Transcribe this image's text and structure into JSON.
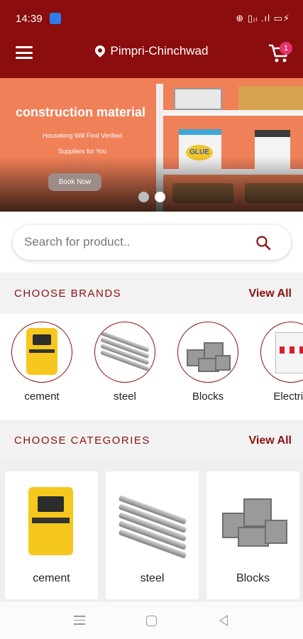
{
  "colors": {
    "brand": "#8b0d0d",
    "accent_text": "#8b1010",
    "badge": "#e4336a",
    "banner_bg": "#f08058"
  },
  "status_bar": {
    "time": "14:39",
    "icons": "⊕ ▯ᵢₗ .ıl ▭⚡"
  },
  "header": {
    "location": "Pimpri-Chinchwad",
    "cart_count": "1"
  },
  "banner": {
    "title": "construction material",
    "subtitle_line1": "Houseking Will Find Verified",
    "subtitle_line2": "Suppliers for You",
    "button": "Book Now",
    "glue_label": "GLUE",
    "slides": 2,
    "active_slide": 2
  },
  "search": {
    "placeholder": "Search for product.."
  },
  "brands_section": {
    "title": "CHOOSE BRANDS",
    "view_all": "View All",
    "items": [
      {
        "label": "cement",
        "icon": "cement-bag-icon"
      },
      {
        "label": "steel",
        "icon": "steel-rebar-icon"
      },
      {
        "label": "Blocks",
        "icon": "concrete-blocks-icon"
      },
      {
        "label": "Electric",
        "icon": "electric-switchboard-icon"
      }
    ]
  },
  "categories_section": {
    "title": "CHOOSE CATEGORIES",
    "view_all": "View All",
    "items": [
      {
        "label": "cement",
        "icon": "cement-bag-icon"
      },
      {
        "label": "steel",
        "icon": "steel-rebar-icon"
      },
      {
        "label": "Blocks",
        "icon": "concrete-blocks-icon"
      }
    ]
  },
  "navbar": {
    "icons": [
      "recent-apps-icon",
      "home-icon",
      "back-icon"
    ]
  }
}
